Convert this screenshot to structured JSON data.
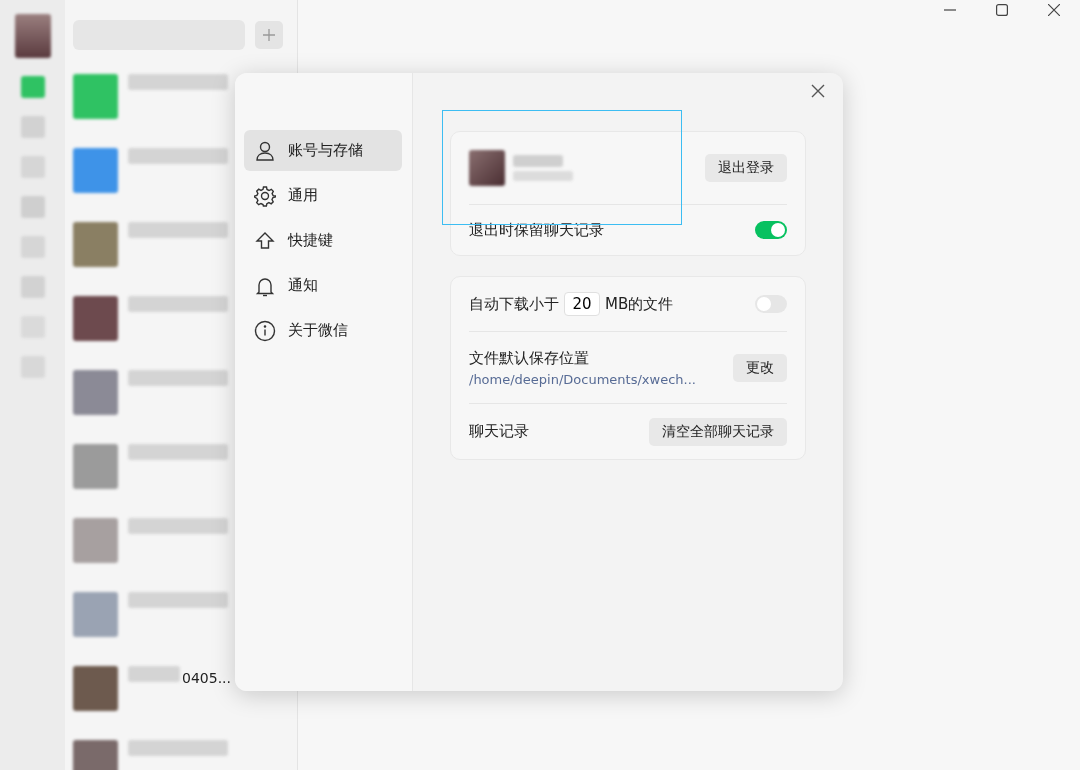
{
  "chat_list": {
    "fragment": "0405..."
  },
  "settings_dialog": {
    "nav": [
      {
        "kind": "user",
        "label": "账号与存储",
        "selected": true
      },
      {
        "kind": "gear",
        "label": "通用",
        "selected": false
      },
      {
        "kind": "arrow",
        "label": "快捷键",
        "selected": false
      },
      {
        "kind": "bell",
        "label": "通知",
        "selected": false
      },
      {
        "kind": "info",
        "label": "关于微信",
        "selected": false
      }
    ],
    "account": {
      "logout_button": "退出登录",
      "keep_history": {
        "label": "退出时保留聊天记录",
        "on": true
      }
    },
    "storage": {
      "auto_download": {
        "prefix": "自动下载小于",
        "value": "20",
        "suffix": "MB的文件",
        "on": false
      },
      "save_location": {
        "label": "文件默认保存位置",
        "path": "/home/deepin/Documents/xwech...",
        "button": "更改"
      },
      "history": {
        "label": "聊天记录",
        "button": "清空全部聊天记录"
      }
    }
  }
}
